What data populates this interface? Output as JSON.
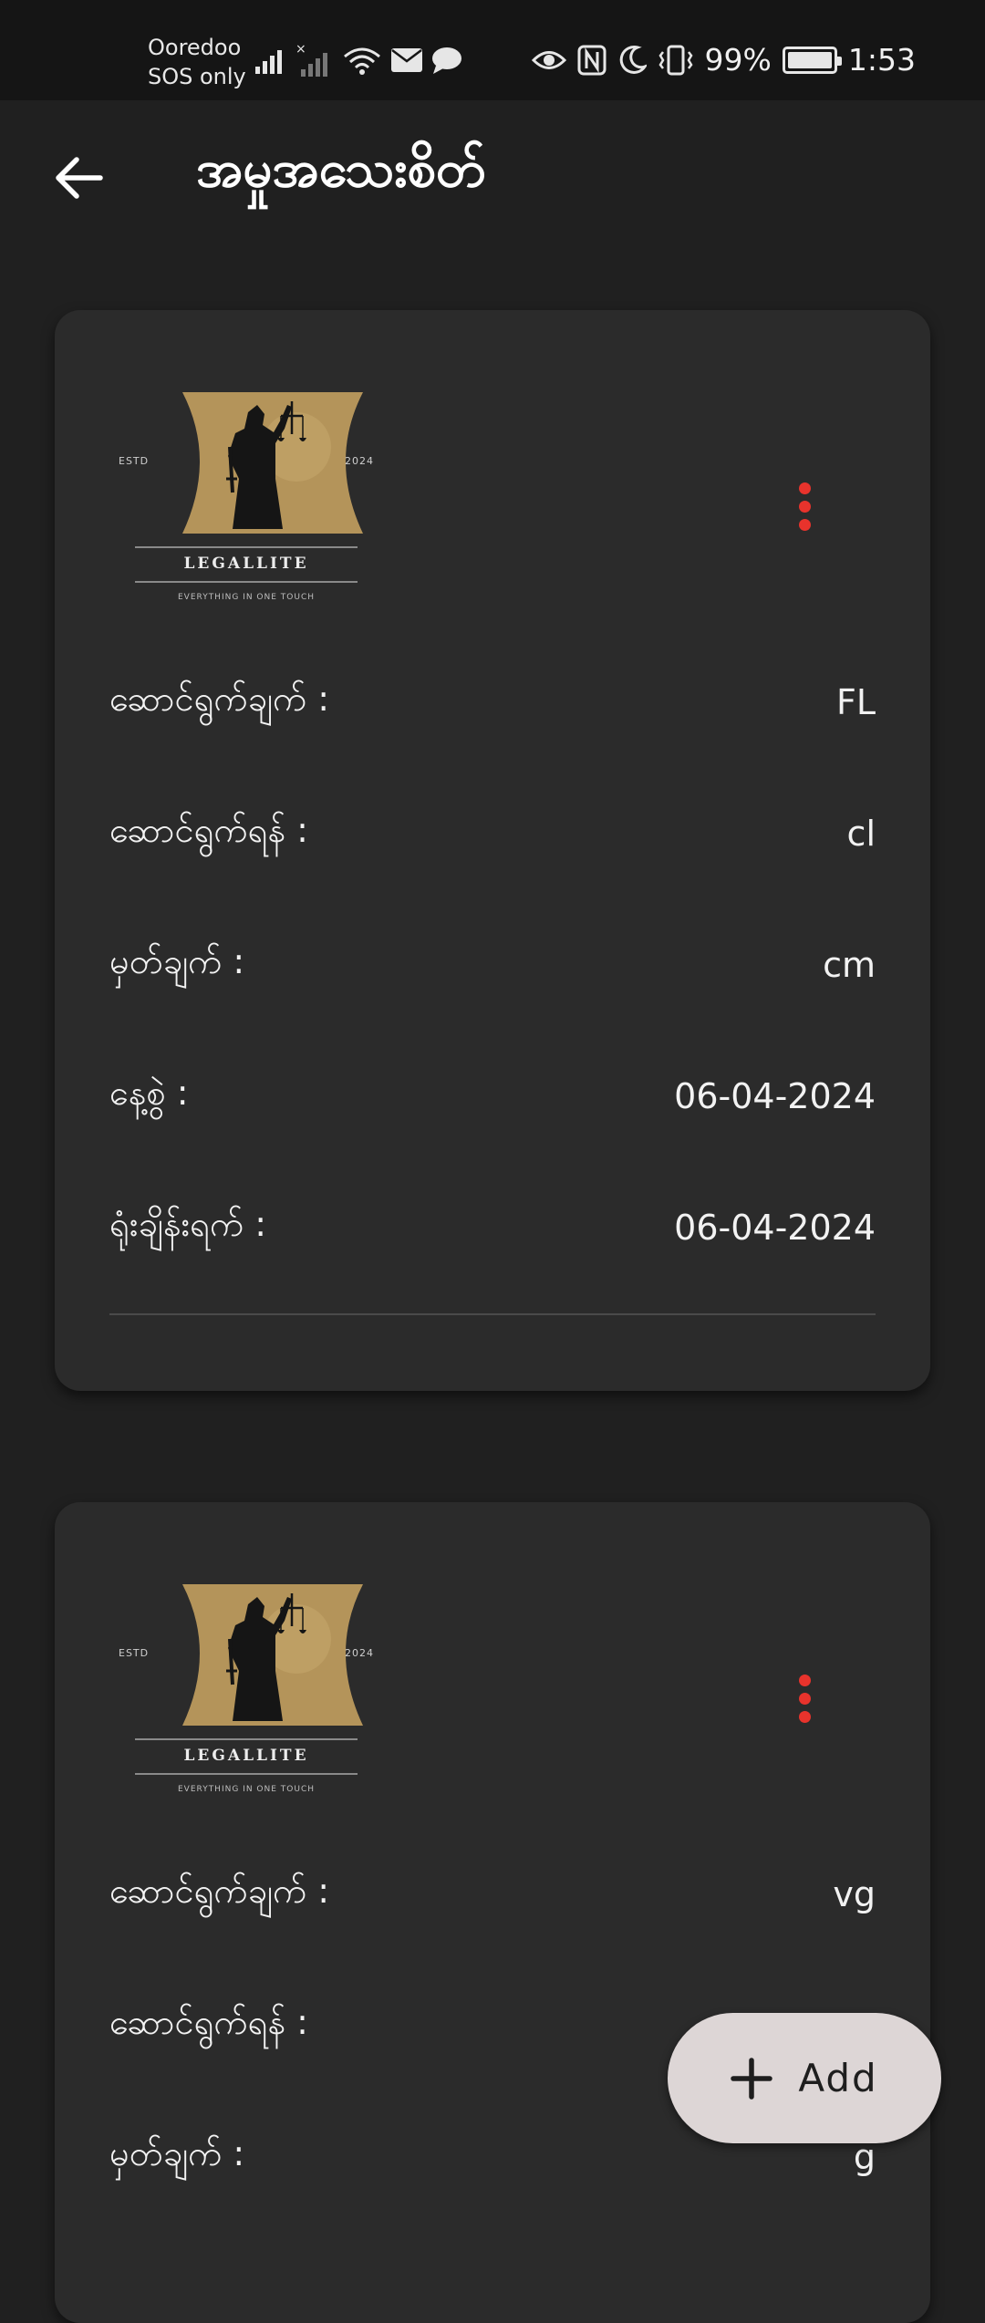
{
  "status_bar": {
    "carrier_name": "Ooredoo",
    "carrier_status": "SOS only",
    "battery_percent": "99%",
    "time": "1:53"
  },
  "app_bar": {
    "title": "အမှုအသေးစိတ်"
  },
  "logo": {
    "name": "LEGALLITE",
    "tagline": "EVERYTHING IN ONE TOUCH",
    "estd": "ESTD",
    "year": "2024"
  },
  "cards": [
    {
      "rows": [
        {
          "label": "ဆောင်ရွက်ချက် :",
          "value": "FL"
        },
        {
          "label": "ဆောင်ရွက်ရန် :",
          "value": "cl"
        },
        {
          "label": "မှတ်ချက် :",
          "value": "cm"
        },
        {
          "label": "နေ့စွဲ :",
          "value": "06-04-2024"
        },
        {
          "label": "ရုံးချိန်းရက် :",
          "value": "06-04-2024"
        }
      ]
    },
    {
      "rows": [
        {
          "label": "ဆောင်ရွက်ချက် :",
          "value": "vg"
        },
        {
          "label": "ဆောင်ရွက်ရန် :",
          "value": ""
        },
        {
          "label": "မှတ်ချက် :",
          "value": "g"
        }
      ]
    }
  ],
  "fab": {
    "label": "Add"
  },
  "colors": {
    "background": "#202020",
    "card": "#2b2b2b",
    "menu_dot": "#e8332c",
    "logo_gold": "#b4945a",
    "fab": "#ddd6d6"
  }
}
